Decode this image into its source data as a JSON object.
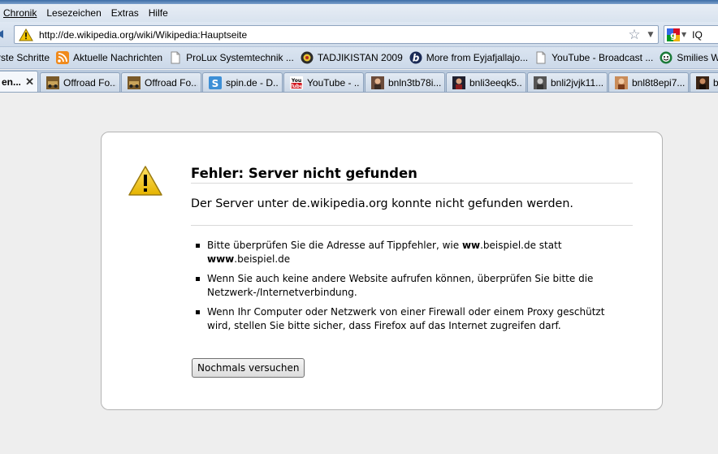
{
  "menu": [
    "Chronik",
    "Lesezeichen",
    "Extras",
    "Hilfe"
  ],
  "nav": {
    "url": "http://de.wikipedia.org/wiki/Wikipedia:Hauptseite",
    "search_text": "IQ"
  },
  "bookmarks": [
    {
      "label": "rste Schritte",
      "icon": "none"
    },
    {
      "label": "Aktuelle Nachrichten",
      "icon": "rss-icon"
    },
    {
      "label": "ProLux Systemtechnik ...",
      "icon": "page-icon"
    },
    {
      "label": "TADJIKISTAN 2009",
      "icon": "emblem-icon"
    },
    {
      "label": "More from Eyjafjallajo...",
      "icon": "b-icon"
    },
    {
      "label": "YouTube - Broadcast ...",
      "icon": "page-icon"
    },
    {
      "label": "Smilies Worl",
      "icon": "smiley-icon"
    }
  ],
  "tabs": [
    {
      "label": "en...",
      "active": true
    },
    {
      "label": "Offroad Fo...",
      "icon": "offroad-icon"
    },
    {
      "label": "Offroad Fo...",
      "icon": "offroad-icon"
    },
    {
      "label": "spin.de - D...",
      "icon": "spin-icon"
    },
    {
      "label": "YouTube - ...",
      "icon": "youtube-icon"
    },
    {
      "label": "bnln3tb78i...",
      "icon": "thumb-icon"
    },
    {
      "label": "bnli3eeqk5...",
      "icon": "thumb-icon"
    },
    {
      "label": "bnli2jvjk11...",
      "icon": "thumb-icon"
    },
    {
      "label": "bnl8t8epi7...",
      "icon": "thumb-icon"
    },
    {
      "label": "b",
      "icon": "thumb-icon"
    }
  ],
  "error": {
    "title": "Fehler: Server nicht gefunden",
    "short_desc": "Der Server unter de.wikipedia.org konnte nicht gefunden werden.",
    "items": [
      {
        "pre": "Bitte überprüfen Sie die Adresse auf Tippfehler, wie ",
        "b1": "ww",
        "mid1": ".beispiel.de statt",
        "b2": "www",
        "end": ".beispiel.de"
      },
      {
        "text": "Wenn Sie auch keine andere Website aufrufen können, überprüfen Sie bitte die Netzwerk-/Internetverbindung."
      },
      {
        "text": "Wenn Ihr Computer oder Netzwerk von einer Firewall oder einem Proxy geschützt wird, stellen Sie bitte sicher, dass Firefox auf das Internet zugreifen darf."
      }
    ],
    "retry_label": "Nochmals versuchen"
  },
  "colors": {
    "accent": "#3d6da6",
    "warning": "#f2c500"
  }
}
